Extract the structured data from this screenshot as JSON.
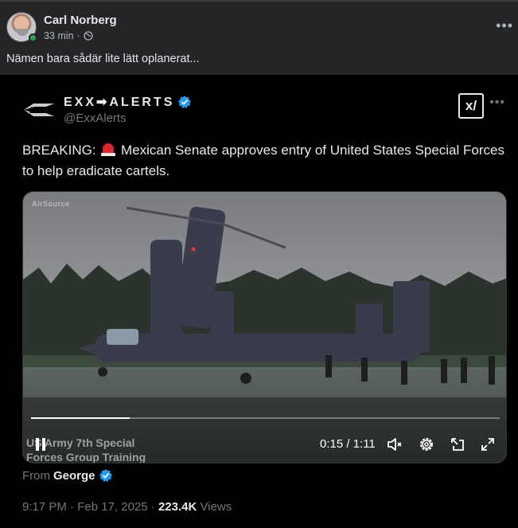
{
  "facebook_post": {
    "author": "Carl Norberg",
    "time": "33 min",
    "privacy_icon": "globe-icon",
    "text": "Nämen bara sådär lite lätt oplanerat..."
  },
  "tweet": {
    "brand_name": "EXX➡ALERTS",
    "handle": "@ExxAlerts",
    "text_before_emoji": "BREAKING: ",
    "emoji": "siren-icon",
    "text_after_emoji": " Mexican Senate approves entry of United States Special Forces to help eradicate cartels.",
    "accent_color": "#1d9bf0"
  },
  "video": {
    "watermark": "AirSource",
    "caption_line1": "US Army 7th Special",
    "caption_line2": "Forces Group Training",
    "time": "0:15 / 1:11",
    "progress": 0.21
  },
  "source": {
    "from_label": "From",
    "name": "George"
  },
  "footer": {
    "time": "9:17 PM",
    "date": "Feb 17, 2025",
    "views": "223.4K",
    "views_label": "Views"
  }
}
